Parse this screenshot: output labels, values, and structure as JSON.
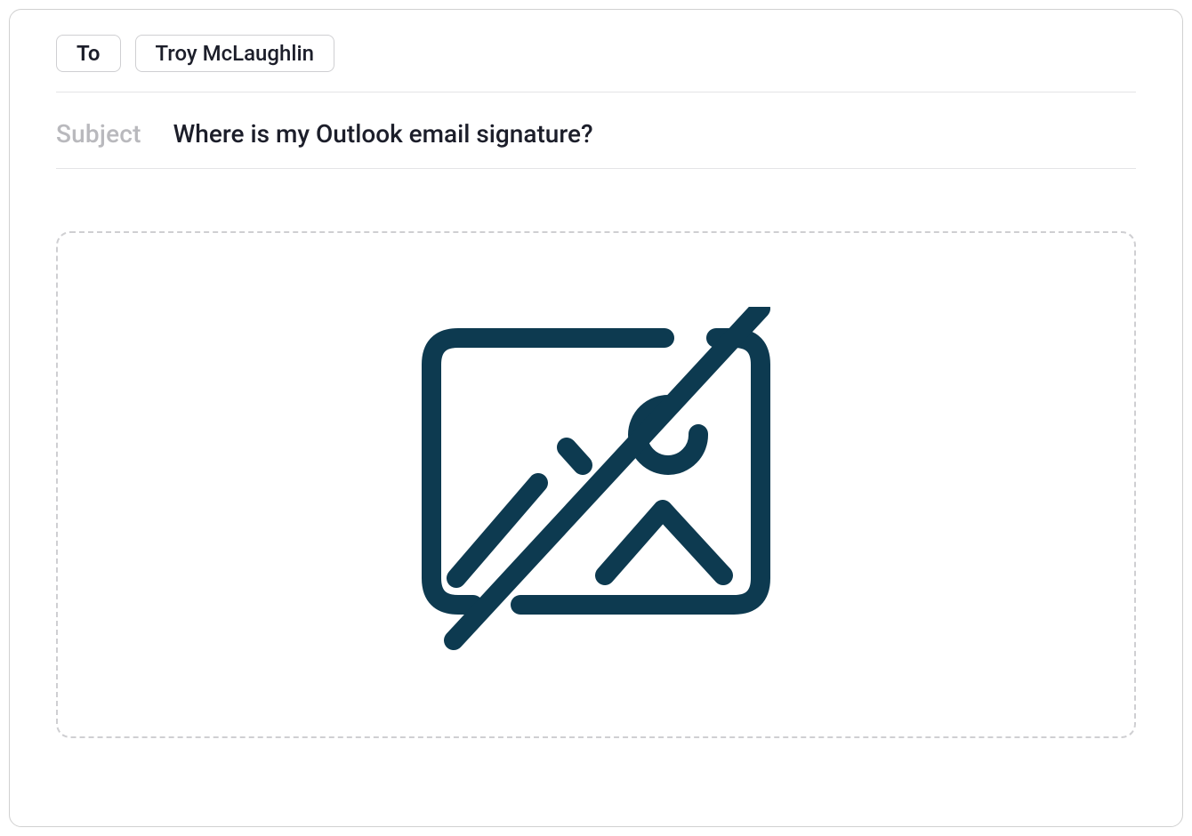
{
  "compose": {
    "to_label": "To",
    "recipients": [
      "Troy McLaughlin"
    ],
    "subject_label": "Subject",
    "subject_value": "Where is my Outlook email signature?"
  },
  "icons": {
    "broken_image": "broken-image-icon"
  },
  "colors": {
    "icon_color": "#0d3a50",
    "border_color": "#cfcfd2",
    "text_color": "#1c1e2a",
    "placeholder_color": "#b9b9bd"
  }
}
